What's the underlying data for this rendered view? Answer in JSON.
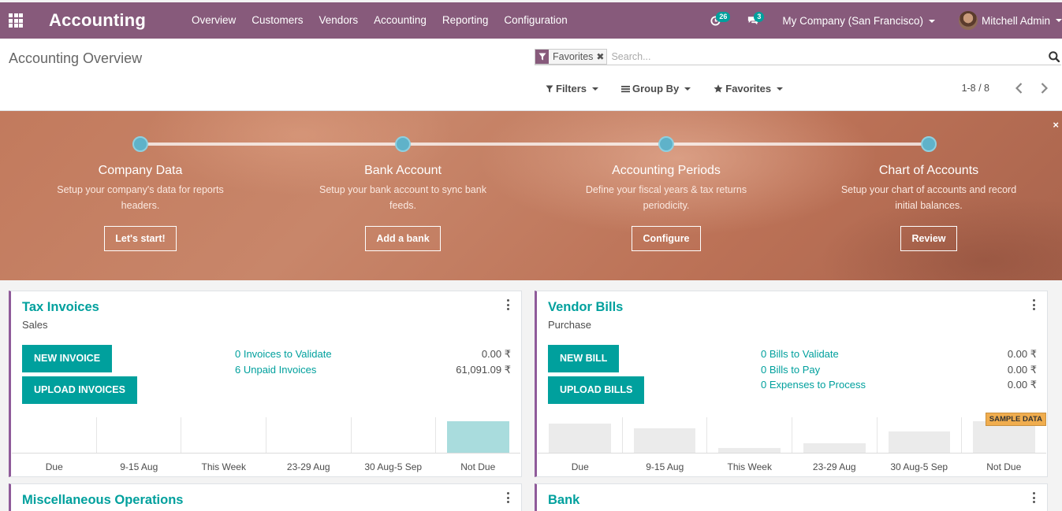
{
  "navbar": {
    "app_name": "Accounting",
    "menu": [
      "Overview",
      "Customers",
      "Vendors",
      "Accounting",
      "Reporting",
      "Configuration"
    ],
    "activity_count": "26",
    "message_count": "3",
    "company": "My Company (San Francisco)",
    "user": "Mitchell Admin",
    "colors": {
      "bar": "#875a7b",
      "badge": "#00a09d"
    }
  },
  "control_panel": {
    "breadcrumb": "Accounting Overview",
    "facet": {
      "label": "Favorites",
      "icon": "filter-icon"
    },
    "search_placeholder": "Search...",
    "filters_label": "Filters",
    "groupby_label": "Group By",
    "favorites_label": "Favorites",
    "pager_value": "1-8 / 8"
  },
  "banner": {
    "steps": [
      {
        "title": "Company Data",
        "description": "Setup your company's data for reports headers.",
        "button": "Let's start!"
      },
      {
        "title": "Bank Account",
        "description": "Setup your bank account to sync bank feeds.",
        "button": "Add a bank"
      },
      {
        "title": "Accounting Periods",
        "description": "Define your fiscal years & tax returns periodicity.",
        "button": "Configure"
      },
      {
        "title": "Chart of Accounts",
        "description": "Setup your chart of accounts and record initial balances.",
        "button": "Review"
      }
    ],
    "close_glyph": "×"
  },
  "cards": {
    "tax_invoices": {
      "title": "Tax Invoices",
      "subtitle": "Sales",
      "buttons": [
        "NEW INVOICE",
        "UPLOAD INVOICES"
      ],
      "links": [
        {
          "label": "0 Invoices to Validate",
          "amount": "0.00 ₹"
        },
        {
          "label": "6 Unpaid Invoices",
          "amount": "61,091.09 ₹"
        }
      ],
      "graph": {
        "categories": [
          "Due",
          "9-15 Aug",
          "This Week",
          "23-29 Aug",
          "30 Aug-5 Sep",
          "Not Due"
        ],
        "values": [
          0,
          0,
          0,
          0,
          0,
          61091.09
        ],
        "bar_color": "#a9dcdd"
      }
    },
    "vendor_bills": {
      "title": "Vendor Bills",
      "subtitle": "Purchase",
      "buttons": [
        "NEW BILL",
        "UPLOAD BILLS"
      ],
      "links": [
        {
          "label": "0 Bills to Validate",
          "amount": "0.00 ₹"
        },
        {
          "label": "0 Bills to Pay",
          "amount": "0.00 ₹"
        },
        {
          "label": "0 Expenses to Process",
          "amount": "0.00 ₹"
        }
      ],
      "graph": {
        "categories": [
          "Due",
          "9-15 Aug",
          "This Week",
          "23-29 Aug",
          "30 Aug-5 Sep",
          "Not Due"
        ],
        "values": [
          40,
          33,
          6,
          13,
          29,
          43
        ],
        "bar_color": "#ebebeb",
        "sample_tag": "SAMPLE DATA"
      }
    },
    "misc_operations": {
      "title": "Miscellaneous Operations"
    },
    "bank": {
      "title": "Bank"
    }
  }
}
